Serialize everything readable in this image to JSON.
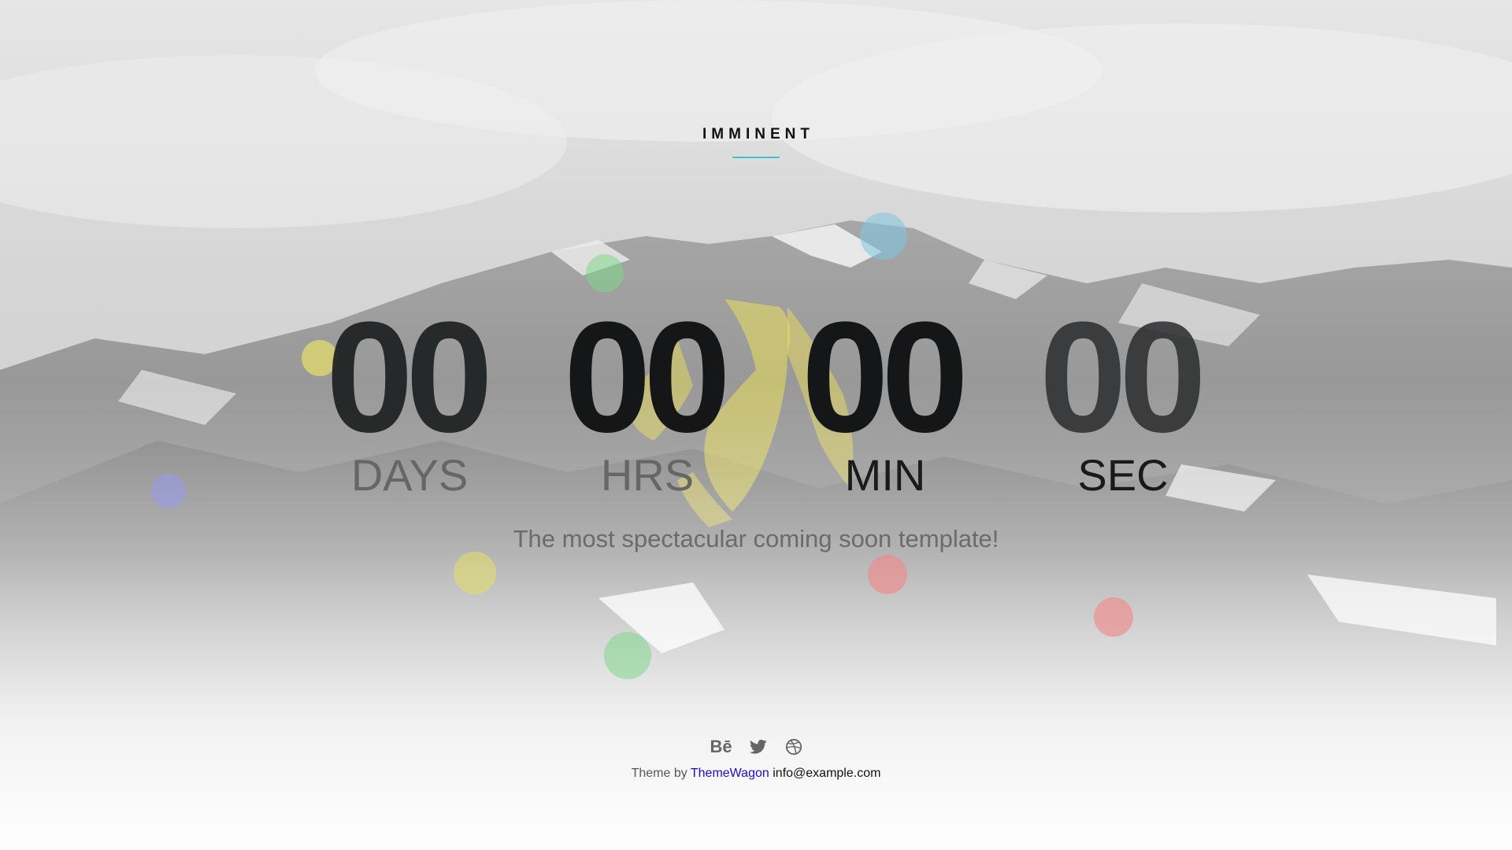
{
  "brand": {
    "title": "IMMINENT",
    "accent_color": "#3fc4c9"
  },
  "countdown": {
    "days": {
      "value": "00",
      "label": "DAYS"
    },
    "hours": {
      "value": "00",
      "label": "HRS"
    },
    "minutes": {
      "value": "00",
      "label": "MIN"
    },
    "seconds": {
      "value": "00",
      "label": "SEC"
    }
  },
  "tagline": "The most spectacular coming soon template!",
  "socials": [
    {
      "name": "behance-icon",
      "glyph": "Bē"
    },
    {
      "name": "twitter-icon"
    },
    {
      "name": "dribbble-icon"
    }
  ],
  "footer": {
    "prefix": "Theme by",
    "link_text": "ThemeWagon",
    "email": "info@example.com"
  },
  "background": {
    "description_colors": [
      "#bfbfbf",
      "#8a8a8a",
      "#f2f2f2"
    ],
    "bubble_colors": [
      "#7fc6e0",
      "#7fd98a",
      "#e6e066",
      "#9a9be0",
      "#ef8a8a"
    ]
  }
}
